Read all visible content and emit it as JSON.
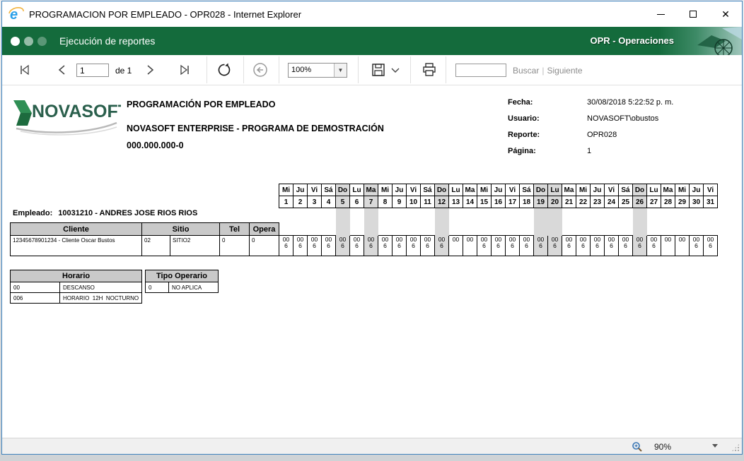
{
  "window": {
    "title": "PROGRAMACION POR EMPLEADO - OPR028 - Internet Explorer"
  },
  "app_header": {
    "title": "Ejecución de reportes",
    "module_label": "OPR - Operaciones"
  },
  "toolbar": {
    "page_input": "1",
    "of_label": "de 1",
    "zoom_select": "100%",
    "search_input": "",
    "buscar_label": "Buscar",
    "divider": "|",
    "siguiente_label": "Siguiente"
  },
  "report": {
    "logo_text": "NOVASOFT",
    "title": "PROGRAMACIÓN POR EMPLEADO",
    "subtitle": "NOVASOFT ENTERPRISE - PROGRAMA DE DEMOSTRACIÓN",
    "nit": "000.000.000-0",
    "meta": [
      {
        "label": "Fecha:",
        "value": "30/08/2018 5:22:52 p. m."
      },
      {
        "label": "Usuario:",
        "value": "NOVASOFT\\obustos"
      },
      {
        "label": "Reporte:",
        "value": "OPR028"
      },
      {
        "label": "Página:",
        "value": "1"
      }
    ],
    "employee_label": "Empleado:",
    "employee_value": "10031210 - ANDRES JOSE RIOS RIOS",
    "calendar": {
      "dows": [
        "Mi",
        "Ju",
        "Vi",
        "Sá",
        "Do",
        "Lu",
        "Ma",
        "Mi",
        "Ju",
        "Vi",
        "Sá",
        "Do",
        "Lu",
        "Ma",
        "Mi",
        "Ju",
        "Vi",
        "Sá",
        "Do",
        "Lu",
        "Ma",
        "Mi",
        "Ju",
        "Vi",
        "Sá",
        "Do",
        "Lu",
        "Ma",
        "Mi",
        "Ju",
        "Vi"
      ],
      "nums": [
        "1",
        "2",
        "3",
        "4",
        "5",
        "6",
        "7",
        "8",
        "9",
        "10",
        "11",
        "12",
        "13",
        "14",
        "15",
        "16",
        "17",
        "18",
        "19",
        "20",
        "21",
        "22",
        "23",
        "24",
        "25",
        "26",
        "27",
        "28",
        "29",
        "30",
        "31"
      ],
      "holidays": [
        5,
        7,
        12,
        19,
        20,
        26
      ]
    },
    "table": {
      "headers": {
        "cliente": "Cliente",
        "sitio": "Sitio",
        "tel": "Tel",
        "opera": "Opera"
      },
      "row": {
        "cliente": "12345678901234 - Cliente Oscar Bustos",
        "sitio_code": "02",
        "sitio_name": "SITIO2",
        "tel": "0",
        "opera": "0",
        "schedule": [
          "006",
          "006",
          "006",
          "006",
          "006",
          "006",
          "006",
          "006",
          "006",
          "006",
          "006",
          "006",
          "00",
          "00",
          "006",
          "006",
          "006",
          "006",
          "006",
          "006",
          "006",
          "006",
          "006",
          "006",
          "006",
          "006",
          "006",
          "00",
          "00",
          "006",
          "006"
        ]
      }
    },
    "legends": {
      "horario": {
        "title": "Horario",
        "rows": [
          [
            "00",
            "DESCANSO"
          ],
          [
            "006",
            "HORARIO  12H  NOCTURNO"
          ]
        ]
      },
      "tipo_operario": {
        "title": "Tipo Operario",
        "rows": [
          [
            "0",
            "NO APLICA"
          ]
        ]
      }
    }
  },
  "statusbar": {
    "zoom_level": "90%"
  },
  "colors": {
    "header_green": "#146b3c",
    "window_border": "#3e82bd",
    "table_header_bg": "#c9c9c9",
    "holiday_bg": "#d9d9d9",
    "logo_green": "#2f8f55",
    "logo_text_green": "#2a5f4c"
  }
}
